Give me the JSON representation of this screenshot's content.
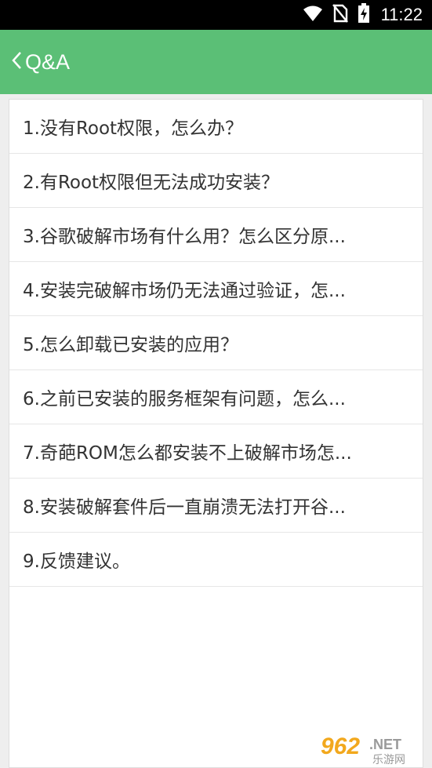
{
  "status_bar": {
    "time": "11:22",
    "icons": [
      "wifi-icon",
      "no-sim-icon",
      "battery-charging-icon"
    ]
  },
  "app_bar": {
    "title": "Q&A",
    "back_icon": "chevron-left-icon",
    "color": "#5bbf76"
  },
  "qa_list": [
    {
      "label": "1.没有Root权限，怎么办？"
    },
    {
      "label": "2.有Root权限但无法成功安装？"
    },
    {
      "label": "3.谷歌破解市场有什么用？怎么区分原..."
    },
    {
      "label": "4.安装完破解市场仍无法通过验证，怎..."
    },
    {
      "label": "5.怎么卸载已安装的应用？"
    },
    {
      "label": "6.之前已安装的服务框架有问题，怎么..."
    },
    {
      "label": "7.奇葩ROM怎么都安装不上破解市场怎..."
    },
    {
      "label": "8.安装破解套件后一直崩溃无法打开谷..."
    },
    {
      "label": "9.反馈建议。"
    }
  ],
  "watermark": {
    "brand": "962.NET",
    "subtitle": "乐游网"
  }
}
